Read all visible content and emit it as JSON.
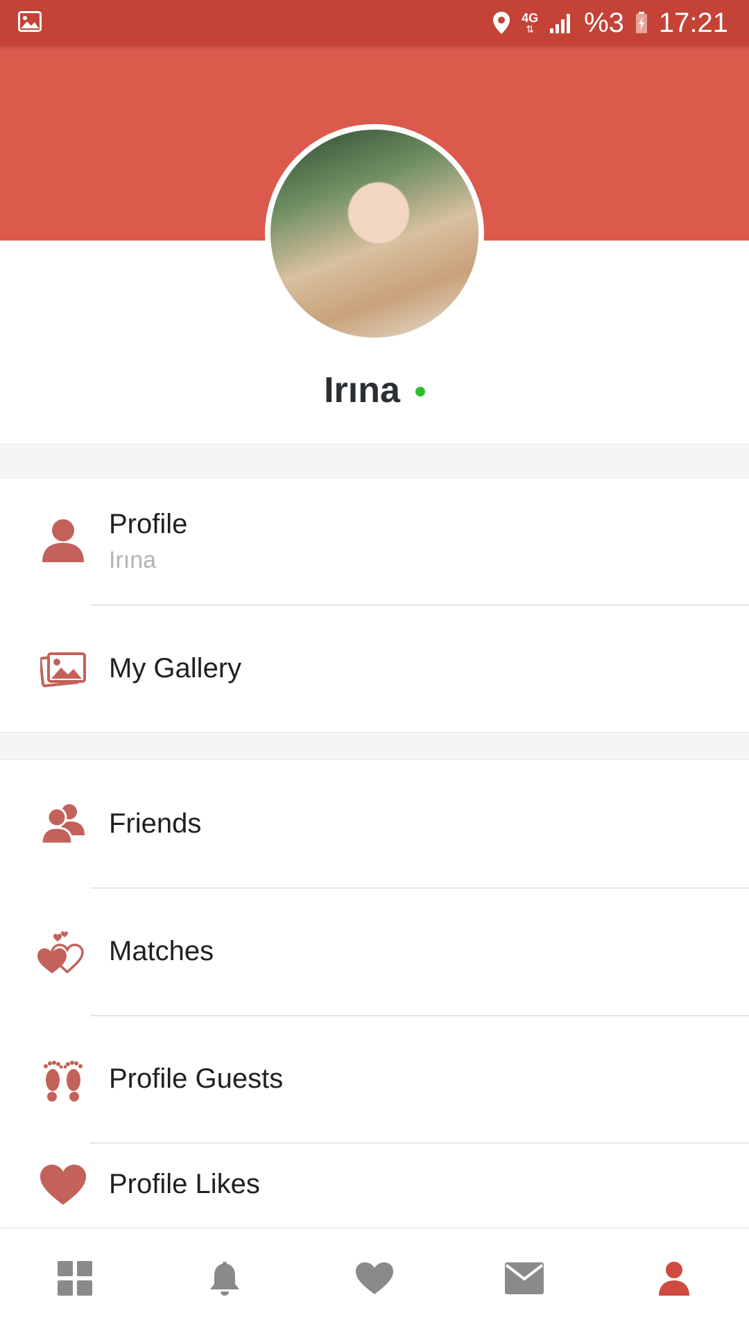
{
  "status_bar": {
    "battery": "%3",
    "time": "17:21",
    "network": "4G",
    "icons": [
      "gallery-notification-icon",
      "location-icon",
      "4g-icon",
      "signal-icon",
      "battery-charging-icon"
    ]
  },
  "profile": {
    "name": "Irına",
    "online": true
  },
  "menu": {
    "profile": {
      "label": "Profile",
      "sublabel": "Irına",
      "icon": "person-icon"
    },
    "gallery": {
      "label": "My Gallery",
      "icon": "photos-icon"
    },
    "friends": {
      "label": "Friends",
      "icon": "friends-icon"
    },
    "matches": {
      "label": "Matches",
      "icon": "hearts-icon"
    },
    "guests": {
      "label": "Profile Guests",
      "icon": "footprints-icon"
    },
    "likes": {
      "label": "Profile Likes",
      "icon": "heart-icon"
    }
  },
  "bottom_nav": {
    "items": [
      "dashboard-icon",
      "bell-icon",
      "heart-icon",
      "mail-icon",
      "person-icon"
    ],
    "active": "person-icon"
  },
  "colors": {
    "status_bar": "#c44336",
    "header": "#db5a4c",
    "accent_icon": "#c2625a",
    "nav_inactive": "#8a8a8a",
    "nav_active": "#d04a3f",
    "online": "#2ebd2e"
  }
}
